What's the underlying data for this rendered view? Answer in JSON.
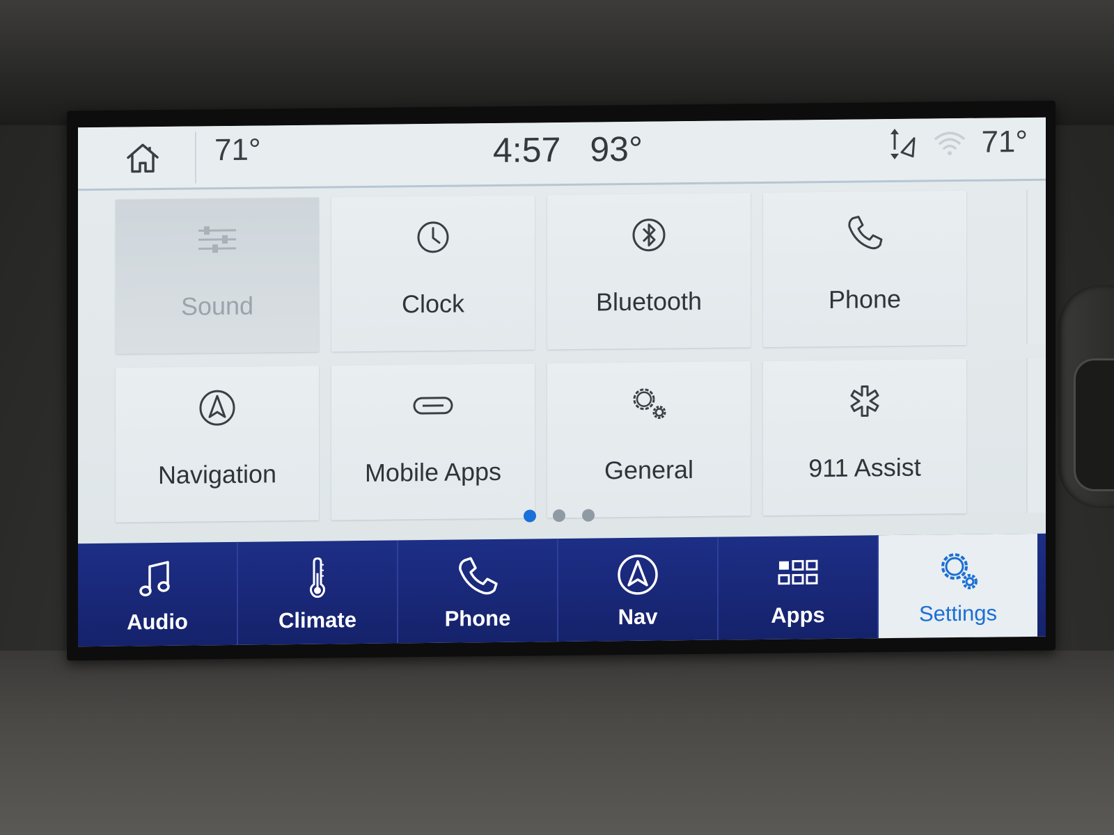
{
  "status_bar": {
    "outside_temp": "71°",
    "time": "4:57",
    "set_temp": "93°",
    "right_temp": "71°",
    "icons": [
      "home-icon",
      "gps-direction-icon",
      "wifi-icon"
    ]
  },
  "tiles": [
    {
      "label": "Sound",
      "icon": "sliders-icon",
      "enabled": false
    },
    {
      "label": "Clock",
      "icon": "clock-icon",
      "enabled": true
    },
    {
      "label": "Bluetooth",
      "icon": "bluetooth-icon",
      "enabled": true
    },
    {
      "label": "Phone",
      "icon": "phone-icon",
      "enabled": true
    },
    {
      "label": "Navigation",
      "icon": "navigation-icon",
      "enabled": true
    },
    {
      "label": "Mobile Apps",
      "icon": "link-icon",
      "enabled": true
    },
    {
      "label": "General",
      "icon": "gears-icon",
      "enabled": true
    },
    {
      "label": "911 Assist",
      "icon": "emergency-asterisk-icon",
      "enabled": true
    }
  ],
  "pagination": {
    "pages": 3,
    "current": 1,
    "active_color": "#1a6fd8"
  },
  "bottom_nav": [
    {
      "label": "Audio",
      "icon": "music-note-icon",
      "active": false
    },
    {
      "label": "Climate",
      "icon": "thermometer-icon",
      "active": false
    },
    {
      "label": "Phone",
      "icon": "phone-icon",
      "active": false
    },
    {
      "label": "Nav",
      "icon": "navigation-icon",
      "active": false
    },
    {
      "label": "Apps",
      "icon": "apps-grid-icon",
      "active": false
    },
    {
      "label": "Settings",
      "icon": "gears-icon",
      "active": true
    }
  ],
  "colors": {
    "nav_bar": "#1d2e86",
    "active_accent": "#1b6fd3",
    "screen_background": "#e4eaed"
  }
}
